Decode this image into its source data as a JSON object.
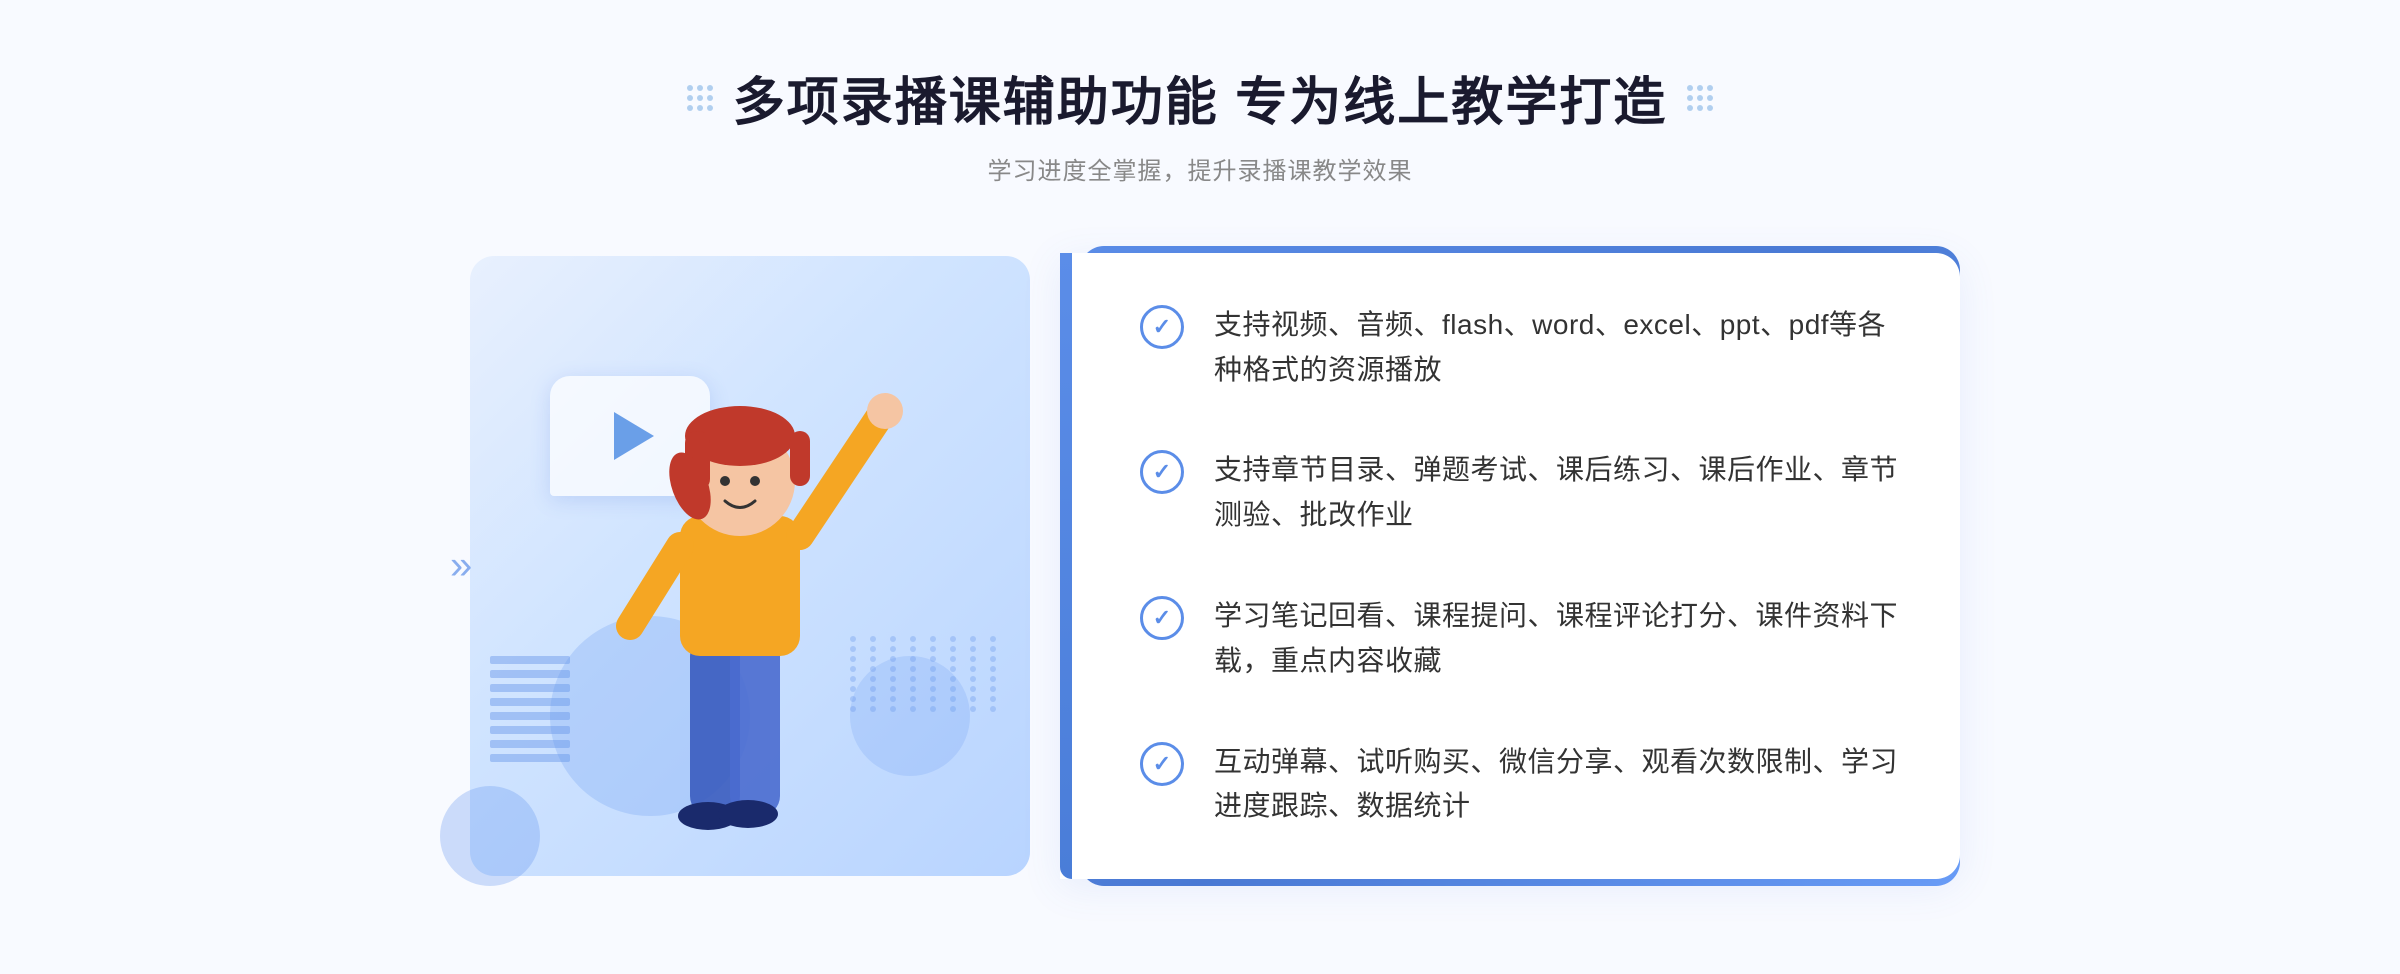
{
  "header": {
    "main_title": "多项录播课辅助功能 专为线上教学打造",
    "subtitle": "学习进度全掌握，提升录播课教学效果"
  },
  "features": [
    {
      "id": 1,
      "text": "支持视频、音频、flash、word、excel、ppt、pdf等各种格式的资源播放"
    },
    {
      "id": 2,
      "text": "支持章节目录、弹题考试、课后练习、课后作业、章节测验、批改作业"
    },
    {
      "id": 3,
      "text": "学习笔记回看、课程提问、课程评论打分、课件资料下载，重点内容收藏"
    },
    {
      "id": 4,
      "text": "互动弹幕、试听购买、微信分享、观看次数限制、学习进度跟踪、数据统计"
    }
  ],
  "decorative": {
    "dots_label": "decorative dots",
    "play_label": "play button"
  }
}
